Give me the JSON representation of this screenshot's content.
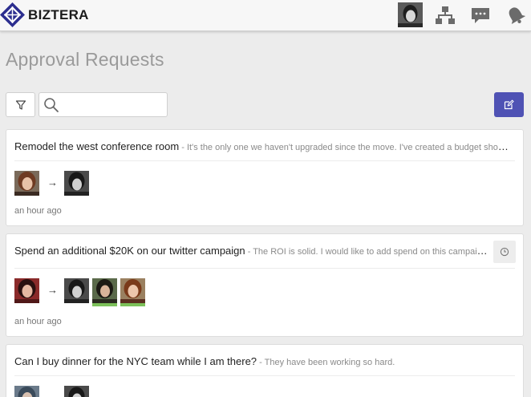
{
  "header": {
    "brand": "BIZTERA",
    "icons": [
      "org-chart-icon",
      "chat-icon",
      "bell-icon"
    ]
  },
  "page": {
    "title": "Approval Requests"
  },
  "toolbar": {
    "search_placeholder": ""
  },
  "requests": [
    {
      "subject": "Remodel the west conference room",
      "description": " - It's the only one we haven't upgraded since the move. I've created a budget show…",
      "time": "an hour ago",
      "approvers_approved": [
        false
      ]
    },
    {
      "subject": "Spend an additional $20K on our twitter campaign",
      "description": " - The ROI is solid. I would like to add spend on this campaig…",
      "time": "an hour ago",
      "approvers_approved": [
        false,
        true,
        true
      ]
    },
    {
      "subject": "Can I buy dinner for the NYC team while I am there?",
      "description": " - They have been working so hard.",
      "time": "",
      "approvers_approved": [
        false
      ]
    }
  ],
  "colors": {
    "primary": "#4f52b4",
    "approved": "#7cc15a",
    "brand": "#2c2e8f"
  }
}
